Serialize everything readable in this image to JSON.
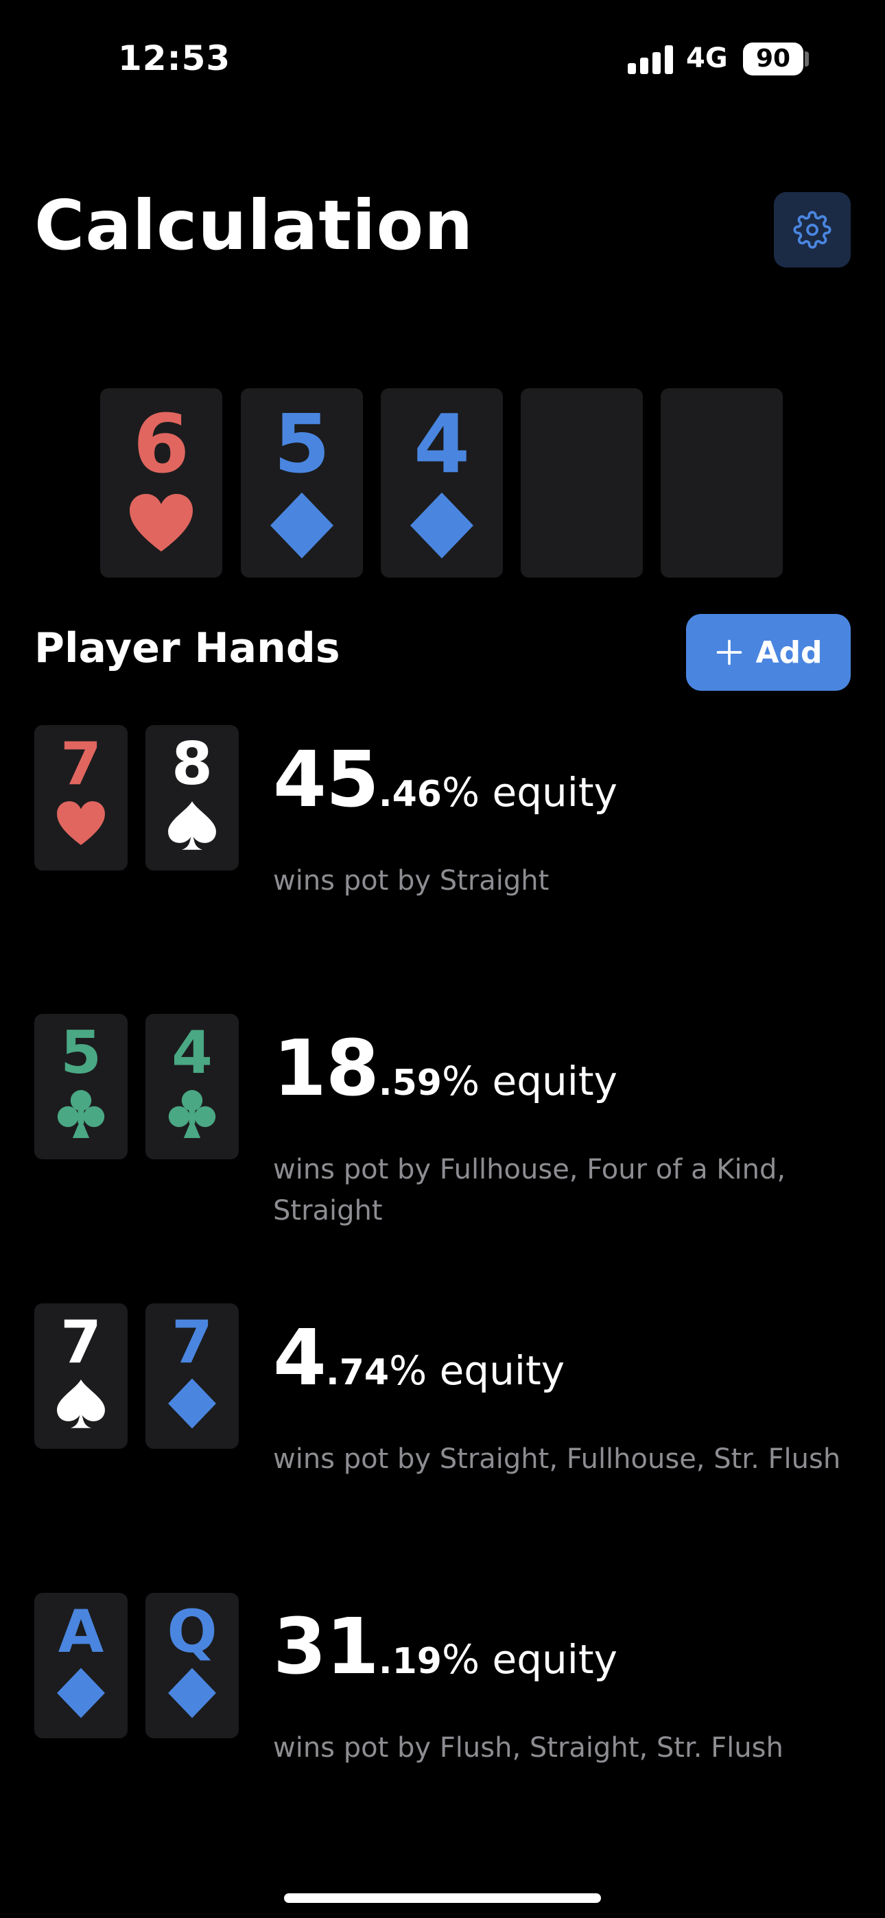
{
  "status_bar": {
    "time": "12:53",
    "network": "4G",
    "battery": "90"
  },
  "header": {
    "title": "Calculation"
  },
  "colors": {
    "heart": "#e0665f",
    "diamond": "#4a86e0",
    "club": "#4aa884",
    "spade": "#ffffff",
    "accent": "#4a86e0"
  },
  "board": [
    {
      "rank": "6",
      "suit": "heart-icon"
    },
    {
      "rank": "5",
      "suit": "diamond-icon"
    },
    {
      "rank": "4",
      "suit": "diamond-icon"
    },
    {
      "rank": "",
      "suit": ""
    },
    {
      "rank": "",
      "suit": ""
    }
  ],
  "players_section": {
    "title": "Player Hands",
    "add_label": "Add"
  },
  "players": [
    {
      "cards": [
        {
          "rank": "7",
          "suit": "heart-icon"
        },
        {
          "rank": "8",
          "suit": "spade-icon"
        }
      ],
      "equity_int": "45",
      "equity_dec": ".46",
      "equity_suffix": "% equity",
      "wins": "wins pot by Straight"
    },
    {
      "cards": [
        {
          "rank": "5",
          "suit": "club-icon"
        },
        {
          "rank": "4",
          "suit": "club-icon"
        }
      ],
      "equity_int": "18",
      "equity_dec": ".59",
      "equity_suffix": "% equity",
      "wins": "wins pot by Fullhouse, Four of a Kind, Straight"
    },
    {
      "cards": [
        {
          "rank": "7",
          "suit": "spade-icon"
        },
        {
          "rank": "7",
          "suit": "diamond-icon"
        }
      ],
      "equity_int": "4",
      "equity_dec": ".74",
      "equity_suffix": "% equity",
      "wins": "wins pot by Straight, Fullhouse, Str. Flush"
    },
    {
      "cards": [
        {
          "rank": "A",
          "suit": "diamond-icon"
        },
        {
          "rank": "Q",
          "suit": "diamond-icon"
        }
      ],
      "equity_int": "31",
      "equity_dec": ".19",
      "equity_suffix": "% equity",
      "wins": "wins pot by Flush, Straight, Str. Flush"
    }
  ]
}
